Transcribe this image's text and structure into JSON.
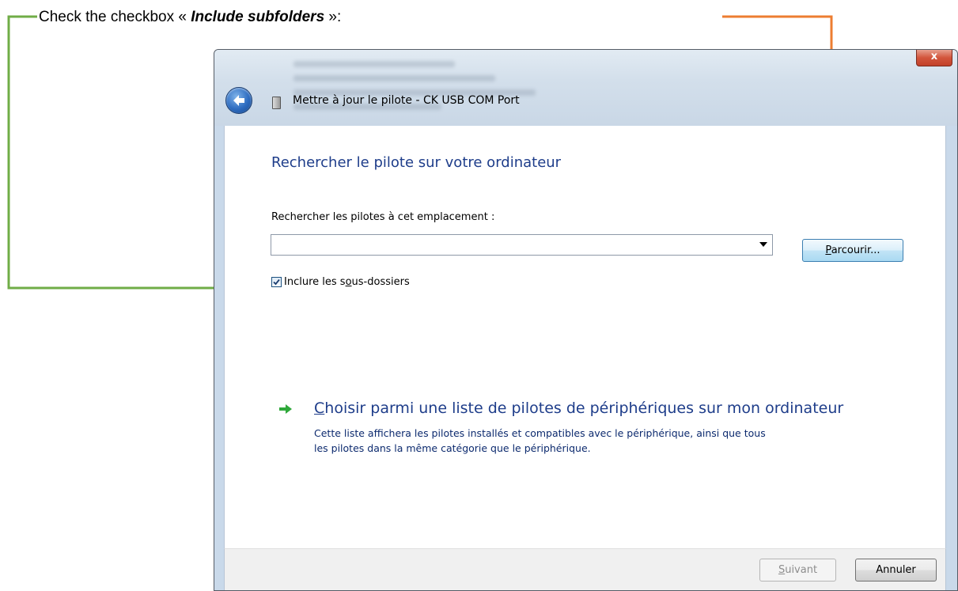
{
  "instruction": {
    "prefix": "Check the checkbox « ",
    "emphasis": "Include subfolders",
    "suffix": " »:"
  },
  "colors": {
    "checkbox_callout_arrow": "#70ad47",
    "browse_callout_arrow": "#ed7d31",
    "heading_blue": "#1e3d8a"
  },
  "window": {
    "title": "Mettre à jour le pilote - CK USB COM Port",
    "close_glyph": "x",
    "back_icon": "back-arrow-icon",
    "device_icon": "usb-device-icon"
  },
  "content": {
    "heading": "Rechercher le pilote sur votre ordinateur",
    "path_label": "Rechercher les pilotes à cet emplacement :",
    "path_value": "",
    "browse_button": {
      "accel": "P",
      "rest": "arcourir..."
    },
    "subfolders_checkbox": {
      "checked": true,
      "label_before": "Inclure les s",
      "label_accel": "o",
      "label_after": "us-dossiers"
    },
    "choose_option": {
      "icon": "green-arrow-icon",
      "title_accel": "C",
      "title_rest": "hoisir parmi une liste de pilotes de périphériques sur mon ordinateur",
      "description": "Cette liste affichera les pilotes installés et compatibles avec le périphérique, ainsi que tous les pilotes dans la même catégorie que le périphérique."
    }
  },
  "footer": {
    "next_button": {
      "accel": "S",
      "rest": "uivant",
      "enabled": false
    },
    "cancel_button": "Annuler"
  }
}
